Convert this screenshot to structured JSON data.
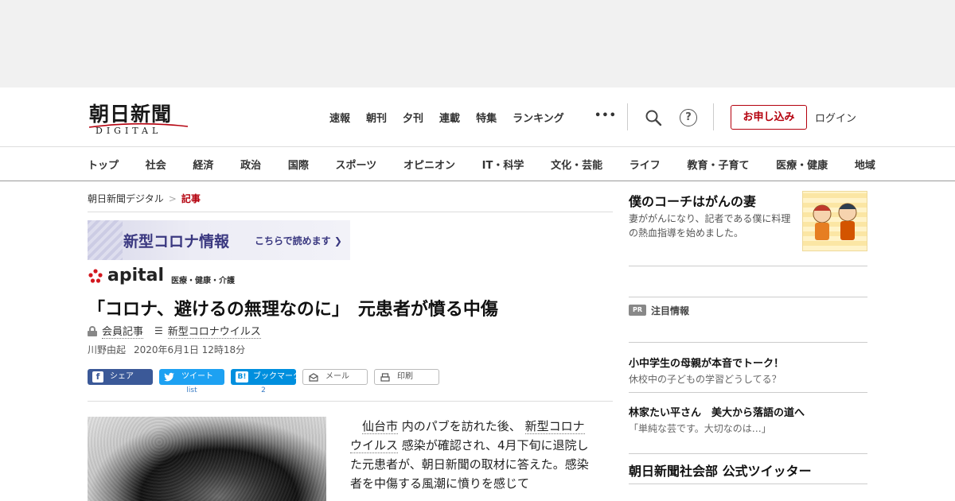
{
  "header": {
    "logo_main": "朝日新聞",
    "logo_sub": "DIGITAL",
    "topnav": [
      "速報",
      "朝刊",
      "夕刊",
      "連載",
      "特集",
      "ランキング"
    ],
    "more": "•••",
    "help_glyph": "?",
    "apply_label": "お申し込み",
    "login_label": "ログイン"
  },
  "categories": [
    "トップ",
    "社会",
    "経済",
    "政治",
    "国際",
    "スポーツ",
    "オピニオン",
    "IT・科学",
    "文化・芸能",
    "ライフ",
    "教育・子育て",
    "医療・健康",
    "地域"
  ],
  "breadcrumb": {
    "home": "朝日新聞デジタル",
    "sep": ">",
    "current": "記事"
  },
  "banner": {
    "title": "新型コロナ情報",
    "link": "こちらで読めます ❯"
  },
  "apital": {
    "name": "apital",
    "category": "医療・健康・介護"
  },
  "article": {
    "headline": "「コロナ、避けるの無理なのに」　元患者が憤る中傷",
    "member_label": "会員記事",
    "topic_label": "新型コロナウイルス",
    "author": "川野由起",
    "date": "2020年6月1日 12時18分",
    "body_link1": "仙台市",
    "body_text1": "内のパブを訪れた後、",
    "body_link2": "新型コロナウイルス",
    "body_text2": "感染が確認され、4月下旬に退院した元患者が、朝日新聞の取材に答えた。感染者を中傷する風潮に憤りを感じて"
  },
  "share": {
    "facebook": "シェア",
    "twitter": "ツイート",
    "hatena": "ブックマーク",
    "mail": "メール",
    "print": "印刷",
    "twitter_count": "list",
    "hatena_count": "2"
  },
  "sidebar": {
    "feature_title": "僕のコーチはがんの妻",
    "feature_desc": "妻ががんになり、記者である僕に料理の熱血指導を始めました。",
    "pr_badge": "PR",
    "pr_label": "注目情報",
    "items": [
      {
        "title": "小中学生の母親が本音でトーク！",
        "sub": "休校中の子どもの学習どうしてる？"
      },
      {
        "title": "林家たい平さん　美大から落語の道へ",
        "sub": "「単純な芸です。大切なのは…」"
      }
    ],
    "twitter_title": "朝日新聞社会部 公式ツイッター"
  }
}
